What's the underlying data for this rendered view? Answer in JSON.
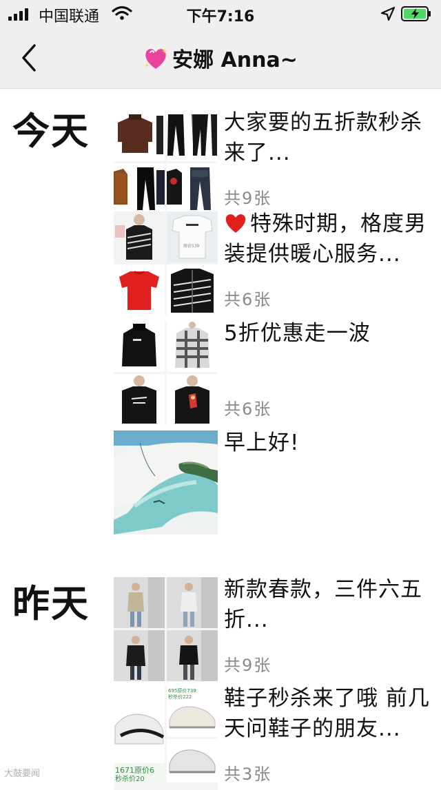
{
  "status_bar": {
    "carrier": "中国联通",
    "time": "下午7:16"
  },
  "nav": {
    "title": "安娜 Anna~",
    "back_icon": "chevron-left-icon"
  },
  "sections": [
    {
      "label": "今天"
    },
    {
      "label": "昨天"
    }
  ],
  "posts": [
    {
      "text": "大家要的五折款秒杀来了...",
      "count": "共9张"
    },
    {
      "text": "特殊时期，格度男装提供暖心服务...",
      "count": "共6张",
      "prefix_icon": "red-heart-icon"
    },
    {
      "text": "5折优惠走一波",
      "count": "共6张"
    },
    {
      "text": "早上好!",
      "count": ""
    },
    {
      "text": "新款春款，三件六五折...",
      "count": "共9张"
    },
    {
      "text": "鞋子秒杀来了哦  前几天问鞋子的朋友...",
      "count": "共3张"
    }
  ],
  "thumb_labels": {
    "shirt_price": "原价539",
    "shoe_price_a": "695原价739",
    "shoe_price_b": "秒杀价222",
    "shoe_price_c": "1671原价6",
    "shoe_price_d": "秒杀价20"
  },
  "watermark": "大鼓要闻"
}
